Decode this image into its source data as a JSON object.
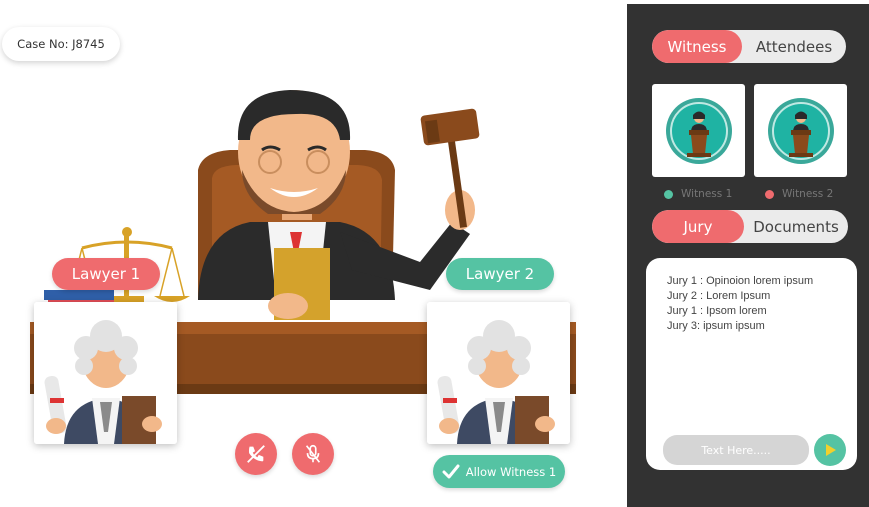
{
  "case": {
    "label": "Case No: J8745"
  },
  "lawyers": [
    {
      "label": "Lawyer 1",
      "color": "#ef6b6e"
    },
    {
      "label": "Lawyer 2",
      "color": "#55c3a3"
    }
  ],
  "controls": {
    "end_call_icon": "phone-off-icon",
    "mute_icon": "mic-off-icon",
    "allow_label": "Allow Witness 1",
    "allow_icon": "check-icon"
  },
  "sidebar": {
    "top_tabs": [
      {
        "label": "Witness",
        "active": true
      },
      {
        "label": "Attendees",
        "active": false
      }
    ],
    "witnesses": [
      {
        "label": "Witness 1",
        "dot_color": "#55c3a3"
      },
      {
        "label": "Witness 2",
        "dot_color": "#ef6b6e"
      }
    ],
    "bottom_tabs": [
      {
        "label": "Jury",
        "active": true
      },
      {
        "label": "Documents",
        "active": false
      }
    ],
    "chat": {
      "messages": [
        "Jury 1 : Opinoion lorem ipsum",
        "Jury 2 : Lorem Ipsum",
        "Jury 1 : Ipsom lorem",
        "Jury 3: ipsum ipsum"
      ],
      "placeholder": "Text Here.....",
      "send_icon": "send-icon"
    }
  },
  "colors": {
    "accent_red": "#ef6b6e",
    "accent_green": "#55c3a3",
    "panel_bg": "#323232"
  }
}
